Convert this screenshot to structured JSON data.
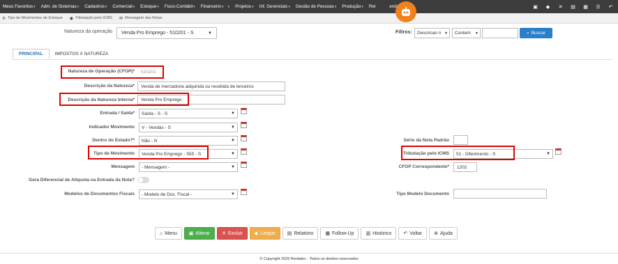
{
  "menu": {
    "items": [
      {
        "label": "Meus Favoritos"
      },
      {
        "label": "Adm. de Sistemas"
      },
      {
        "label": "Cadastros"
      },
      {
        "label": "Comercial"
      },
      {
        "label": "Estoque"
      },
      {
        "label": "Fisco-Contábil"
      },
      {
        "label": "Financeiro"
      },
      {
        "label": "Projetos"
      },
      {
        "label": "Inf. Gerenciais"
      },
      {
        "label": "Gestão de Pessoas"
      },
      {
        "label": "Produção"
      },
      {
        "label": "Rel"
      },
      {
        "label": "endas"
      }
    ],
    "right_icons": [
      "save-icon",
      "eraser-icon",
      "close-icon",
      "grid-icon",
      "table-icon",
      "list-icon",
      "back-icon"
    ]
  },
  "subbar": {
    "items": [
      {
        "label": "Tipo de Movimentos de Estoque",
        "icon": "link-icon"
      },
      {
        "label": "Tributação pelo ICMS",
        "icon": "tax-icon"
      },
      {
        "label": "Mensagem das Notas",
        "icon": "message-icon"
      }
    ]
  },
  "header": {
    "natop_label": "Natureza da operação",
    "natop_value": "Venda Pro Emprego - 510201 - S",
    "filtros_label": "Filtros:",
    "filter_field": "Descricao n",
    "filter_op": "Contem",
    "filter_value": "",
    "buscar_label": "Buscar"
  },
  "tabs": [
    {
      "label": "PRINCIPAL",
      "active": true
    },
    {
      "label": "IMPOSTOS X NATUREZA",
      "active": false
    }
  ],
  "form": {
    "cfop_label": "Natureza de Operação (CFOP)",
    "cfop_value": "510201",
    "desc_label": "Descrição da Natureza",
    "desc_value": "Venda de mercadoria adquirida ou recebida de terceiros",
    "desc_int_label": "Descrição da Natureza Interna",
    "desc_int_value": "Venda Pro Emprego",
    "entrada_label": "Entrada / Saída",
    "entrada_value": "Saída - S - S",
    "indicador_label": "Indicador Movimento",
    "indicador_value": "V - Vendas - S",
    "dentro_label": "Dentro do Estado?",
    "dentro_value": "Não - N",
    "tipo_mov_label": "Tipo de Movimento",
    "tipo_mov_value": "Venda Pro Emprego - 555 - S",
    "mensagem_label": "Mensagem",
    "mensagem_value": "- Mensagem -",
    "difal_label": "Gera Diferencial de Alíquota na Entrada da Nota?",
    "difal_on": false,
    "modelos_label": "Modelos de Documentos Fiscais",
    "modelos_value": "- Modelo de Doc. Fiscal -",
    "serie_label": "Série da Nota Padrão",
    "serie_value": "",
    "trib_label": "Tributação pelo ICMS",
    "trib_value": "51 - Diferimento - S",
    "cfop_corr_label": "CFOP Correspondente",
    "cfop_corr_value": "1202",
    "tipo_modelo_label": "Tipo Modelo Documento",
    "tipo_modelo_value": "",
    "required_mark": "*"
  },
  "buttons": {
    "menu": "Menu",
    "alterar": "Alterar",
    "excluir": "Excluir",
    "limpar": "Limpar",
    "relatorio": "Relatório",
    "followup": "Follow-Up",
    "historico": "Histórico",
    "voltar": "Voltar",
    "ajuda": "Ajuda"
  },
  "footer": {
    "text": "© Copyright 2025 Rentatec - Todos os direitos reservados"
  },
  "colors": {
    "menubar": "#3c3c3c",
    "accent": "#f0821e",
    "highlight": "#e00000",
    "primary": "#2a7fc9"
  }
}
